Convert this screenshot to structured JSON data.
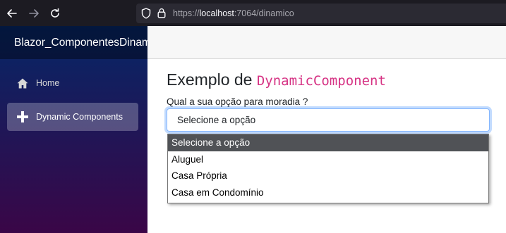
{
  "browser": {
    "url_prefix": "https://",
    "url_host": "localhost",
    "url_suffix": ":7064/dinamico"
  },
  "sidebar": {
    "brand": "Blazor_ComponentesDinamicos",
    "items": [
      {
        "label": "Home",
        "icon": "home-icon"
      },
      {
        "label": "Dynamic Components",
        "icon": "plus-icon"
      }
    ]
  },
  "main": {
    "title_text": "Exemplo de ",
    "title_code": "DynamicComponent",
    "question": "Qual a sua opção para moradia ?",
    "select_value": "Selecione a opção",
    "options": [
      "Selecione a opção",
      "Aluguel",
      "Casa Própria",
      "Casa em Condomínio"
    ]
  }
}
